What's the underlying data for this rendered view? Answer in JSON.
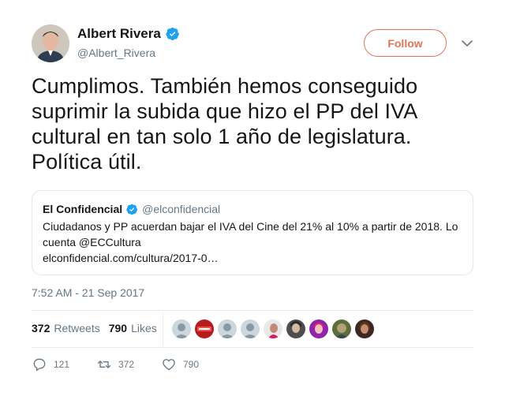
{
  "author": {
    "name": "Albert Rivera",
    "handle": "@Albert_Rivera",
    "verified": true
  },
  "follow_button": {
    "label": "Follow",
    "color": "#e0745b"
  },
  "tweet": {
    "text": "Cumplimos. También hemos conseguido suprimir la subida que hizo el PP del IVA cultural en tan solo 1 año de legislatura. Política útil."
  },
  "quoted_tweet": {
    "name": "El Confidencial",
    "handle": "@elconfidencial",
    "verified": true,
    "text_line1": "Ciudadanos y PP acuerdan bajar el IVA del Cine del 21% al 10% a partir de 2018. Lo cuenta @ECCultura",
    "link": "elconfidencial.com/cultura/2017-0…"
  },
  "timestamp": "7:52 AM - 21 Sep 2017",
  "stats": {
    "retweets_count": "372",
    "retweets_label": "Retweets",
    "likes_count": "790",
    "likes_label": "Likes"
  },
  "liked_by_avatars": [
    "avatar-1",
    "avatar-2",
    "avatar-3",
    "avatar-4",
    "avatar-5",
    "avatar-6",
    "avatar-7",
    "avatar-8",
    "avatar-9"
  ],
  "actions": {
    "replies": "121",
    "retweets": "372",
    "likes": "790"
  },
  "colors": {
    "verified_blue": "#1da1f2",
    "secondary_text": "#657786",
    "border": "#e1e8ed"
  }
}
